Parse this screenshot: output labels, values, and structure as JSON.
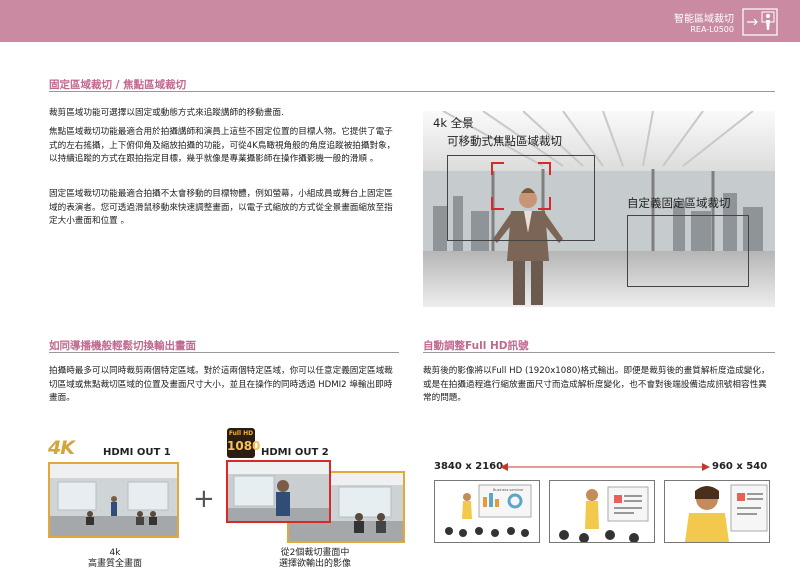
{
  "header": {
    "title": "智能區域裁切",
    "model": "REA-L0500"
  },
  "section1": {
    "title": "固定區域裁切 / 焦點區域裁切",
    "p1": "裁剪區域功能可選擇以固定或動態方式來追蹤講師的移動畫面.",
    "p2": "焦點區域裁切功能最適合用於拍攝講師和演員上這些不固定位置的目標人物。它提供了電子式的左右搖攝，上下俯仰角及縮放拍攝的功能，可從4K鳥瞰視角般的角度追蹤被拍攝對象，以持續追蹤的方式在跟拍指定目標，幾乎就像是專業攝影師在操作攝影機一般的滑順 。",
    "p3": "固定區域裁切功能最適合拍攝不太會移動的目標物體，例如螢幕，小組成員或舞台上固定區域的表演者。您可透過滑鼠移動來快速調整畫面，以電子式縮放的方式從全景畫面縮放至指定大小畫面和位置 。"
  },
  "scene": {
    "label_full": "4k 全景",
    "label_focus": "可移動式焦點區域裁切",
    "label_fixed": "自定義固定區域裁切",
    "accent": "#d62a2a"
  },
  "section2": {
    "title": "如同導播機般輕鬆切換輸出畫面",
    "p1": "拍攝時最多可以同時裁剪兩個特定區域。對於這兩個特定區域，你可以任意定義固定區域裁切區域或焦點裁切區域的位置及畫面尺寸大小，並且在操作的同時透過 HDMI2 埠輸出即時畫面。",
    "badge_4k": "4K",
    "badge_fullhd_top": "Full HD",
    "badge_fullhd_num": "1080",
    "hdmi1": "HDMI OUT 1",
    "hdmi2": "HDMI OUT 2",
    "plus": "+",
    "caption1": "4k\n高畫質全畫面",
    "caption1_a": "4k",
    "caption1_b": "高畫質全畫面",
    "caption2_a": "從2個裁切畫面中",
    "caption2_b": "選擇欲輸出的影像"
  },
  "section3": {
    "title": "自動調整Full HD訊號",
    "p1": "裁剪後的影像將以Full HD (1920x1080)格式輸出。即便是裁剪後的畫質解析度造成變化， 或是在拍攝過程進行縮放畫面尺寸而造成解析度變化，也不會對後端設備造成訊號相容性異常的問題。",
    "res_left": "3840 x 2160",
    "res_right": "960 x 540",
    "slide_title": "Business seminar"
  }
}
